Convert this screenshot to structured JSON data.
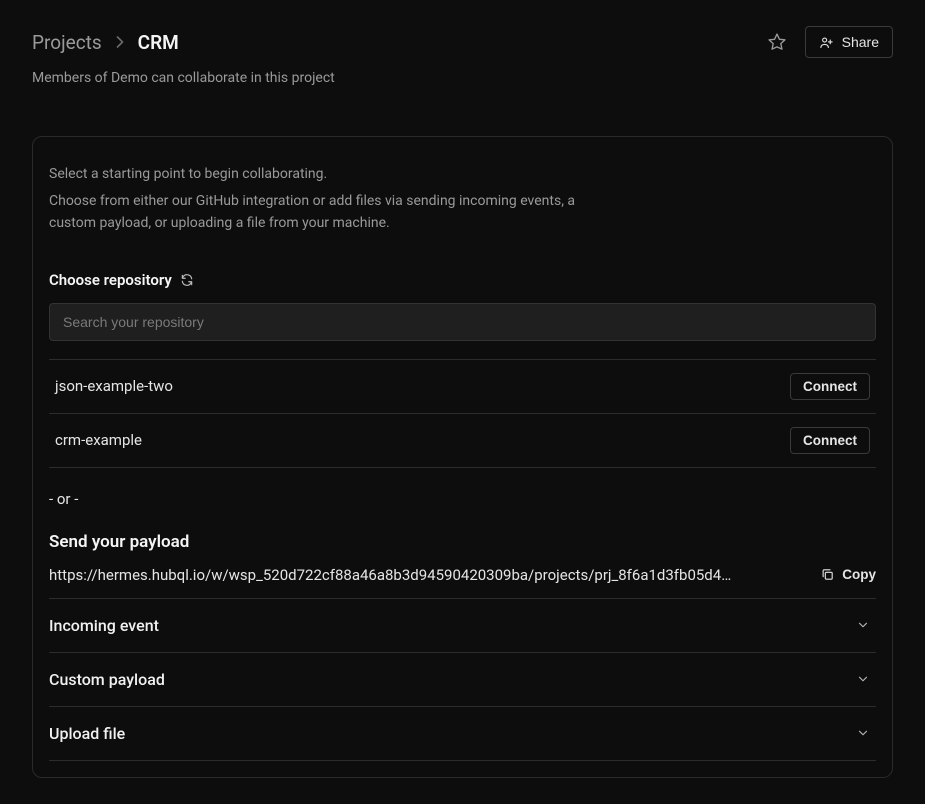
{
  "breadcrumb": {
    "root": "Projects",
    "current": "CRM"
  },
  "header": {
    "share_label": "Share"
  },
  "subtitle": "Members of Demo can collaborate in this project",
  "intro": {
    "line1": "Select a starting point to begin collaborating.",
    "line2": "Choose from either our GitHub integration or add files via sending incoming events, a custom payload, or uploading a file from your machine."
  },
  "repo_section": {
    "title": "Choose repository",
    "search_placeholder": "Search your repository",
    "connect_label": "Connect",
    "items": [
      {
        "name": "json-example-two"
      },
      {
        "name": "crm-example"
      }
    ]
  },
  "or_label": "- or -",
  "payload_section": {
    "title": "Send your payload",
    "url": "https://hermes.hubql.io/w/wsp_520d722cf88a46a8b3d94590420309ba/projects/prj_8f6a1d3fb05d4…",
    "copy_label": "Copy"
  },
  "accordion": {
    "items": [
      {
        "label": "Incoming event"
      },
      {
        "label": "Custom payload"
      },
      {
        "label": "Upload file"
      }
    ]
  }
}
